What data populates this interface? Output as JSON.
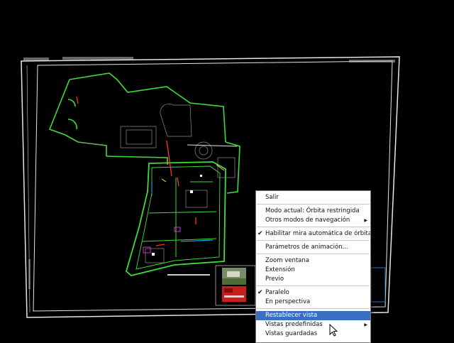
{
  "context_menu": {
    "groups": [
      [
        {
          "label": "Salir"
        }
      ],
      [
        {
          "label": "Modo actual: Órbita restringida"
        },
        {
          "label": "Otros modos de navegación",
          "submenu": true
        }
      ],
      [
        {
          "label": "Habilitar mira automática de órbita",
          "checked": true
        }
      ],
      [
        {
          "label": "Parámetros de animación..."
        }
      ],
      [
        {
          "label": "Zoom ventana"
        },
        {
          "label": "Extensión"
        },
        {
          "label": "Previo"
        }
      ],
      [
        {
          "label": "Paralelo",
          "checked": true
        },
        {
          "label": "En perspectiva"
        }
      ],
      [
        {
          "label": "Restablecer vista",
          "highlighted": true
        },
        {
          "label": "Vistas predefinidas",
          "submenu": true
        },
        {
          "label": "Vistas guardadas"
        }
      ]
    ]
  },
  "colors": {
    "background": "#000000",
    "plan_lines": "#3ddc3d",
    "sheet_border": "#e6e6e6",
    "menu_highlight": "#3b6fc4",
    "title_block_red": "#c81e1e"
  },
  "icons": {
    "cursor": "arrow-pointer-icon",
    "check": "check-mark-icon",
    "submenu": "submenu-arrow-icon"
  }
}
